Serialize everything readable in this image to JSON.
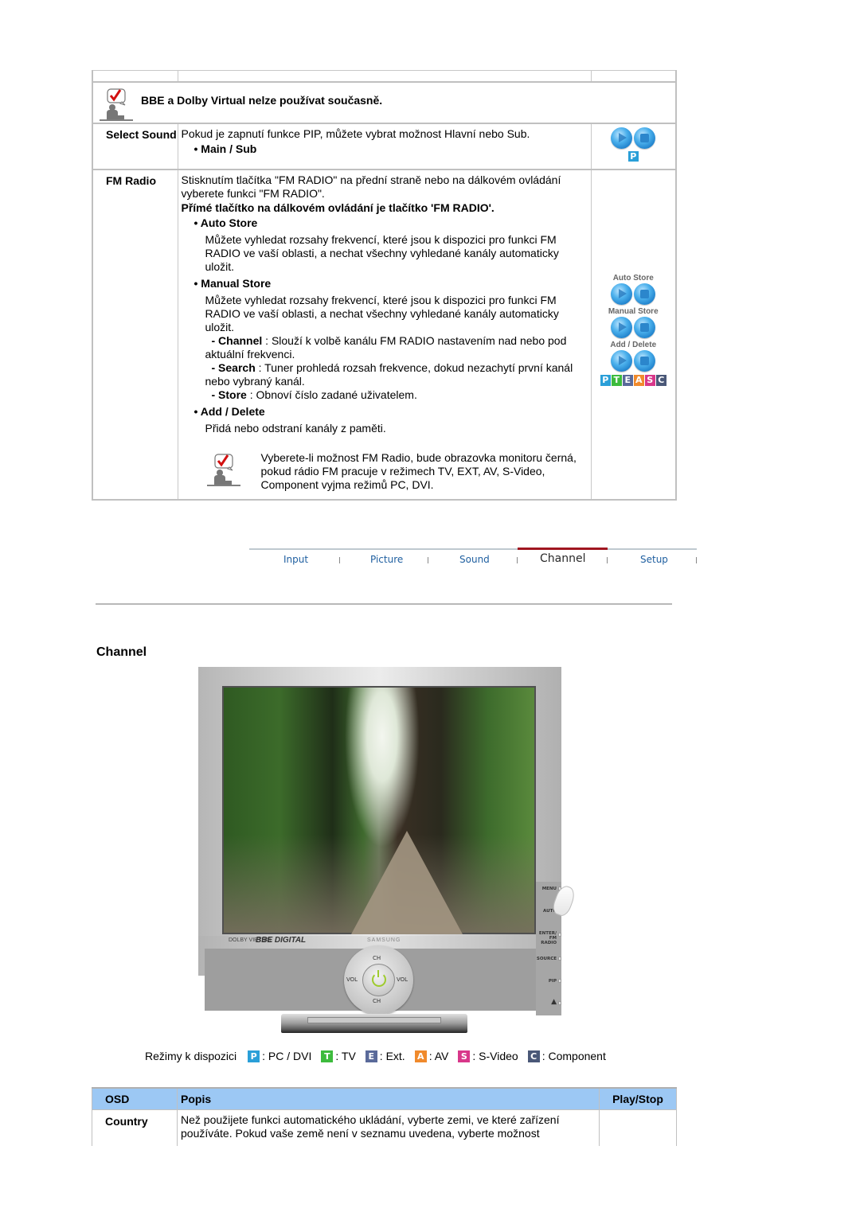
{
  "top_table": {
    "note": {
      "icon": "note-check-icon",
      "text": "BBE a Dolby Virtual nelze používat současně."
    },
    "rows": [
      {
        "label": "Select Sound",
        "description": "Pokud je zapnutí funkce PIP, můžete vybrat možnost Hlavní nebo Sub.",
        "bullet": "• Main / Sub",
        "icons": [
          "play-icon",
          "stop-icon"
        ],
        "mode_badge": "P"
      },
      {
        "label": "FM Radio",
        "description": "Stisknutím tlačítka \"FM RADIO\" na přední straně nebo na dálkovém ovládání vyberete funkci \"FM RADIO\".",
        "bold_line": "Přímé tlačítko na dálkovém ovládání je tlačítko 'FM RADIO'.",
        "auto_store": {
          "title": "• Auto Store",
          "text": "Můžete vyhledat rozsahy frekvencí, které jsou k dispozici pro funkci FM RADIO ve vaší oblasti, a nechat všechny vyhledané kanály automaticky uložit."
        },
        "manual_store": {
          "title": "• Manual Store",
          "text": "Můžete vyhledat rozsahy frekvencí, které jsou k dispozici pro funkci FM RADIO ve vaší oblasti, a nechat všechny vyhledané kanály automaticky uložit.",
          "items": [
            {
              "term": "- Channel",
              "text": " : Slouží k volbě kanálu FM RADIO nastavením nad nebo pod aktuální frekvenci."
            },
            {
              "term": "- Search",
              "text": " : Tuner prohledá rozsah frekvence, dokud nezachytí první kanál nebo vybraný kanál."
            },
            {
              "term": "- Store",
              "text": " : Obnoví číslo zadané uživatelem."
            }
          ]
        },
        "add_delete": {
          "title": "• Add / Delete",
          "text": "Přidá nebo odstraní kanály z paměti."
        },
        "note": "Vyberete-li možnost FM Radio, bude obrazovka monitoru černá, pokud rádio FM pracuje v režimech TV, EXT, AV, S-Video, Component vyjma režimů PC, DVI.",
        "icon_captions": [
          "Auto Store",
          "Manual Store",
          "Add / Delete"
        ],
        "mode_badges": [
          "P",
          "T",
          "E",
          "A",
          "S",
          "C"
        ]
      }
    ]
  },
  "nav": {
    "items": [
      "Input",
      "Picture",
      "Sound",
      "Channel",
      "Setup"
    ],
    "active": "Channel"
  },
  "section_title": "Channel",
  "monitor": {
    "brand_left": "DOLBY VIRTUAL",
    "bbe": "BBE DIGITAL",
    "brand": "SAMSUNG",
    "dpad": {
      "up": "CH",
      "down": "CH",
      "left": "VOL",
      "right": "VOL"
    },
    "side_buttons": [
      "MENU",
      "AUTO",
      "ENTER/ FM RADIO",
      "SOURCE",
      "PIP"
    ]
  },
  "modes": {
    "label": "Režimy k dispozici",
    "items": [
      {
        "badge": "P",
        "color": "#2a9fd8",
        "text": ": PC / DVI"
      },
      {
        "badge": "T",
        "color": "#3dbb3d",
        "text": ": TV"
      },
      {
        "badge": "E",
        "color": "#5a6a9a",
        "text": ": Ext."
      },
      {
        "badge": "A",
        "color": "#f08a2c",
        "text": ": AV"
      },
      {
        "badge": "S",
        "color": "#d8378a",
        "text": ": S-Video"
      },
      {
        "badge": "C",
        "color": "#4a5878",
        "text": ": Component"
      }
    ]
  },
  "osd_table": {
    "headers": [
      "OSD",
      "Popis",
      "Play/Stop"
    ],
    "rows": [
      {
        "osd": "Country",
        "description": "Než použijete funkci automatického ukládání, vyberte zemi, ve které zařízení používáte. Pokud vaše země není v seznamu uvedena, vyberte možnost"
      }
    ]
  },
  "colors": {
    "header_bg": "#9cc8f4",
    "nav_active": "#a01520",
    "nav_text": "#1f5fa0"
  }
}
